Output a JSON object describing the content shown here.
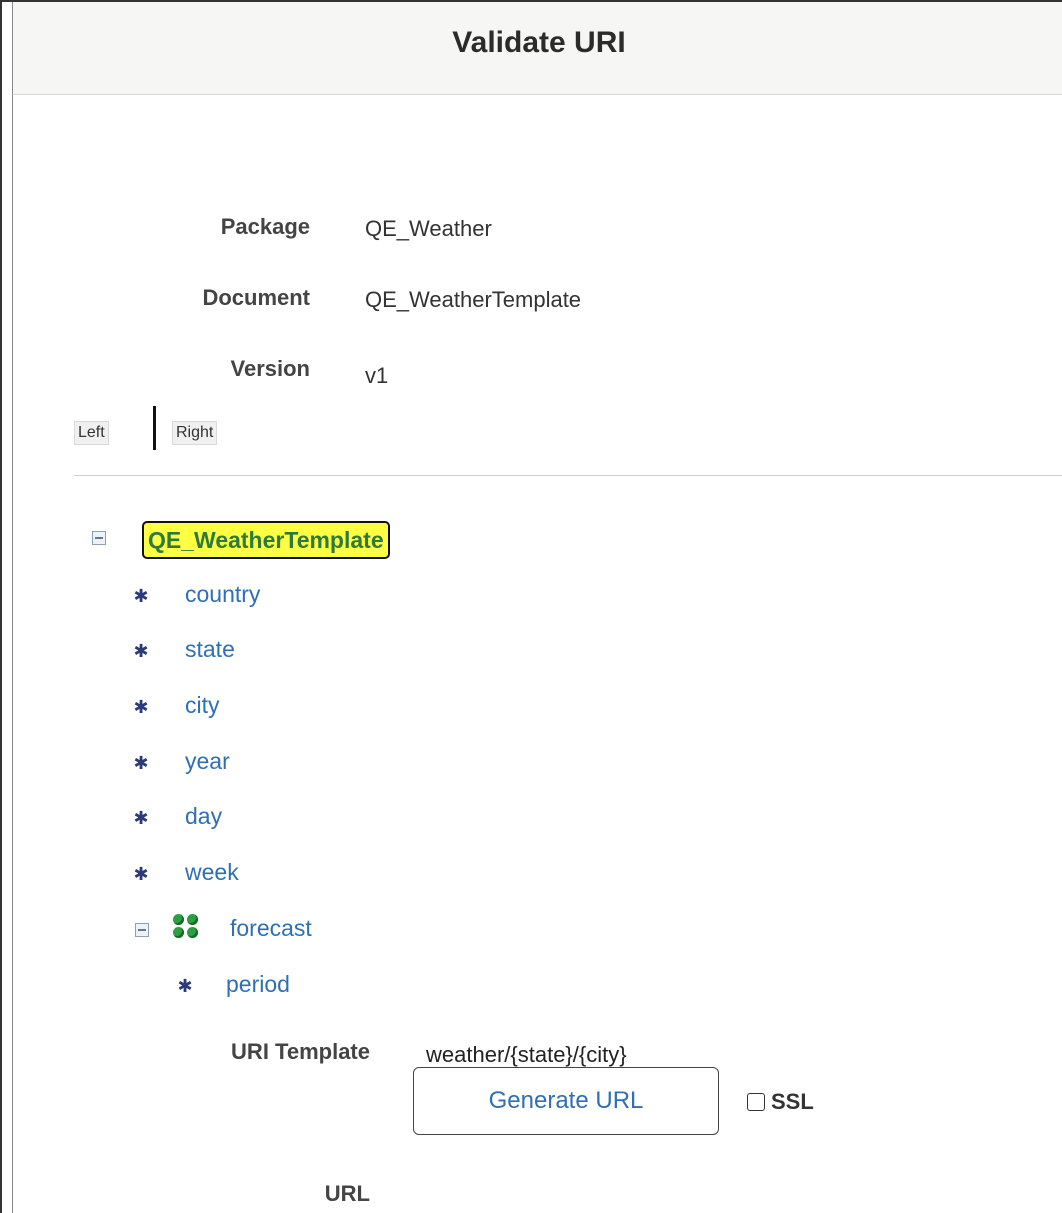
{
  "window": {
    "title": "Validate URI"
  },
  "info": {
    "package_label": "Package",
    "package_value": "QE_Weather",
    "document_label": "Document",
    "document_value": "QE_WeatherTemplate",
    "version_label": "Version",
    "version_value": "v1"
  },
  "tabs": {
    "left": "Left",
    "right": "Right"
  },
  "tree": {
    "root": "QE_WeatherTemplate",
    "fields": [
      "country",
      "state",
      "city",
      "year",
      "day",
      "week"
    ],
    "group": {
      "label": "forecast",
      "children": [
        "period"
      ]
    }
  },
  "uri": {
    "template_label": "URI Template",
    "template_value": "weather/{state}/{city}",
    "generate_button": "Generate URL",
    "ssl_label": "SSL",
    "ssl_checked": false,
    "url_label": "URL"
  }
}
